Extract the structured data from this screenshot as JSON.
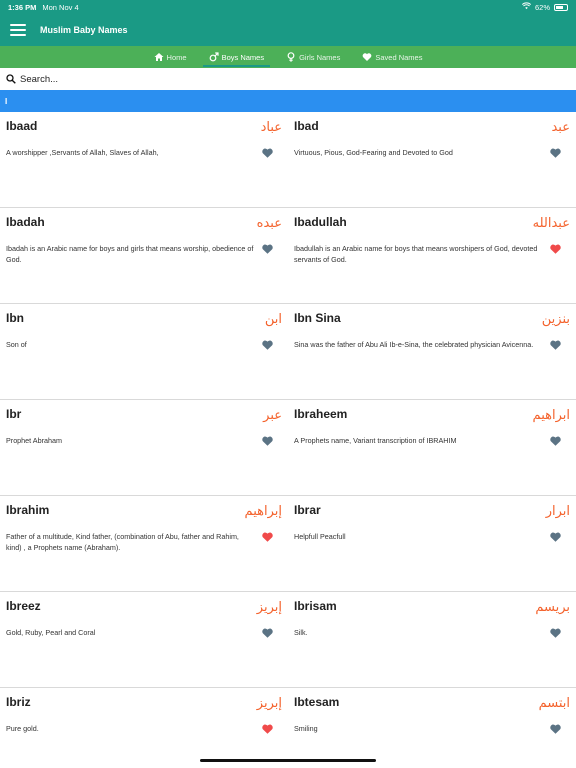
{
  "status": {
    "time": "1:36 PM",
    "date": "Mon Nov 4",
    "battery": "62%"
  },
  "app": {
    "title": "Muslim Baby Names"
  },
  "tabs": [
    {
      "label": "Home",
      "icon": "home-icon"
    },
    {
      "label": "Boys Names",
      "icon": "male-icon",
      "active": true
    },
    {
      "label": "Girls Names",
      "icon": "female-icon"
    },
    {
      "label": "Saved Names",
      "icon": "heart-icon"
    }
  ],
  "search": {
    "placeholder": "Search..."
  },
  "letter": "I",
  "colors": {
    "header": "#1a9a85",
    "tabs": "#4cb058",
    "letterbar": "#2b8ff0",
    "arabic": "#f4622c",
    "heart_saved": "#f04a4a",
    "heart_default": "#5b7384"
  },
  "names": [
    {
      "name": "Ibaad",
      "arabic": "عباد",
      "meaning": "A worshipper ,Servants of Allah, Slaves of Allah,",
      "saved": false
    },
    {
      "name": "Ibad",
      "arabic": "عبد",
      "meaning": "Virtuous, Pious, God-Fearing and Devoted to God",
      "saved": false
    },
    {
      "name": "Ibadah",
      "arabic": "عبده",
      "meaning": "Ibadah is an Arabic name for boys and girls that means worship, obedience of God.",
      "saved": false
    },
    {
      "name": "Ibadullah",
      "arabic": "عبدالله",
      "meaning": "Ibadullah is an Arabic name for boys that means worshipers of God, devoted servants of God.",
      "saved": true
    },
    {
      "name": "Ibn",
      "arabic": "ابن",
      "meaning": "Son of",
      "saved": false
    },
    {
      "name": "Ibn Sina",
      "arabic": "بنزين",
      "meaning": "Sina was the father of Abu Ali Ib-e-Sina, the celebrated physician Avicenna.",
      "saved": false
    },
    {
      "name": "Ibr",
      "arabic": "عبر",
      "meaning": "Prophet Abraham",
      "saved": false
    },
    {
      "name": "Ibraheem",
      "arabic": "ابراهيم",
      "meaning": "A Prophets name, Variant transcription of IBRAHIM",
      "saved": false
    },
    {
      "name": "Ibrahim",
      "arabic": "إبراهيم",
      "meaning": "Father of a multitude, Kind father, (combination of Abu, father and Rahim, kind) , a Prophets name (Abraham).",
      "saved": true
    },
    {
      "name": "Ibrar",
      "arabic": "ابرار",
      "meaning": "Helpfull Peacfull",
      "saved": false
    },
    {
      "name": "Ibreez",
      "arabic": "إبريز",
      "meaning": "Gold, Ruby, Pearl and Coral",
      "saved": false
    },
    {
      "name": "Ibrisam",
      "arabic": "بريسم",
      "meaning": "Silk.",
      "saved": false
    },
    {
      "name": "Ibriz",
      "arabic": "إبريز",
      "meaning": "Pure gold.",
      "saved": true
    },
    {
      "name": "Ibtesam",
      "arabic": "ابتسم",
      "meaning": "Smiling",
      "saved": false
    }
  ]
}
